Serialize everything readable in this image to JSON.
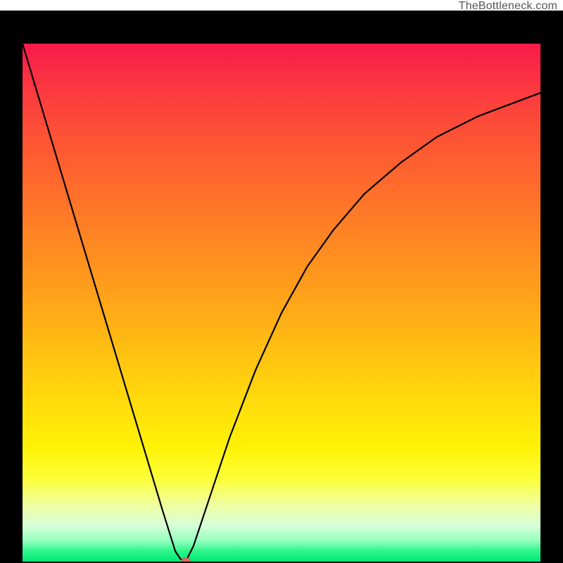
{
  "watermark": "TheBottleneck.com",
  "chart_data": {
    "type": "line",
    "title": "",
    "xlabel": "",
    "ylabel": "",
    "xlim": [
      0,
      100
    ],
    "ylim": [
      0,
      100
    ],
    "grid": false,
    "legend": false,
    "series": [
      {
        "name": "bottleneck-curve",
        "x": [
          0,
          3,
          6,
          9,
          12,
          15,
          18,
          21,
          24,
          27,
          29.5,
          30.5,
          31.5,
          33,
          36,
          40,
          45,
          50,
          55,
          60,
          66,
          73,
          80,
          88,
          96,
          100
        ],
        "values": [
          100,
          90,
          80,
          70,
          60,
          50,
          40,
          30,
          20,
          10,
          2,
          0.5,
          0,
          3,
          12,
          24,
          37,
          48,
          57,
          64,
          71,
          77,
          82,
          86,
          89,
          90.5
        ]
      }
    ],
    "marker": {
      "x": 31.5,
      "y": 0,
      "color": "#d16a5a"
    },
    "gradient_stops": [
      {
        "pos": 0.0,
        "color": "#f81a4b"
      },
      {
        "pos": 0.08,
        "color": "#fb3641"
      },
      {
        "pos": 0.17,
        "color": "#fd5036"
      },
      {
        "pos": 0.27,
        "color": "#ff6a2c"
      },
      {
        "pos": 0.37,
        "color": "#ff8423"
      },
      {
        "pos": 0.48,
        "color": "#ffa01a"
      },
      {
        "pos": 0.58,
        "color": "#ffbc12"
      },
      {
        "pos": 0.68,
        "color": "#ffd80c"
      },
      {
        "pos": 0.78,
        "color": "#fff207"
      },
      {
        "pos": 0.84,
        "color": "#fcff38"
      },
      {
        "pos": 0.89,
        "color": "#f0ffa0"
      },
      {
        "pos": 0.93,
        "color": "#d8ffd8"
      },
      {
        "pos": 0.96,
        "color": "#93ffc0"
      },
      {
        "pos": 0.98,
        "color": "#2cf58a"
      },
      {
        "pos": 1.0,
        "color": "#00e878"
      }
    ]
  }
}
